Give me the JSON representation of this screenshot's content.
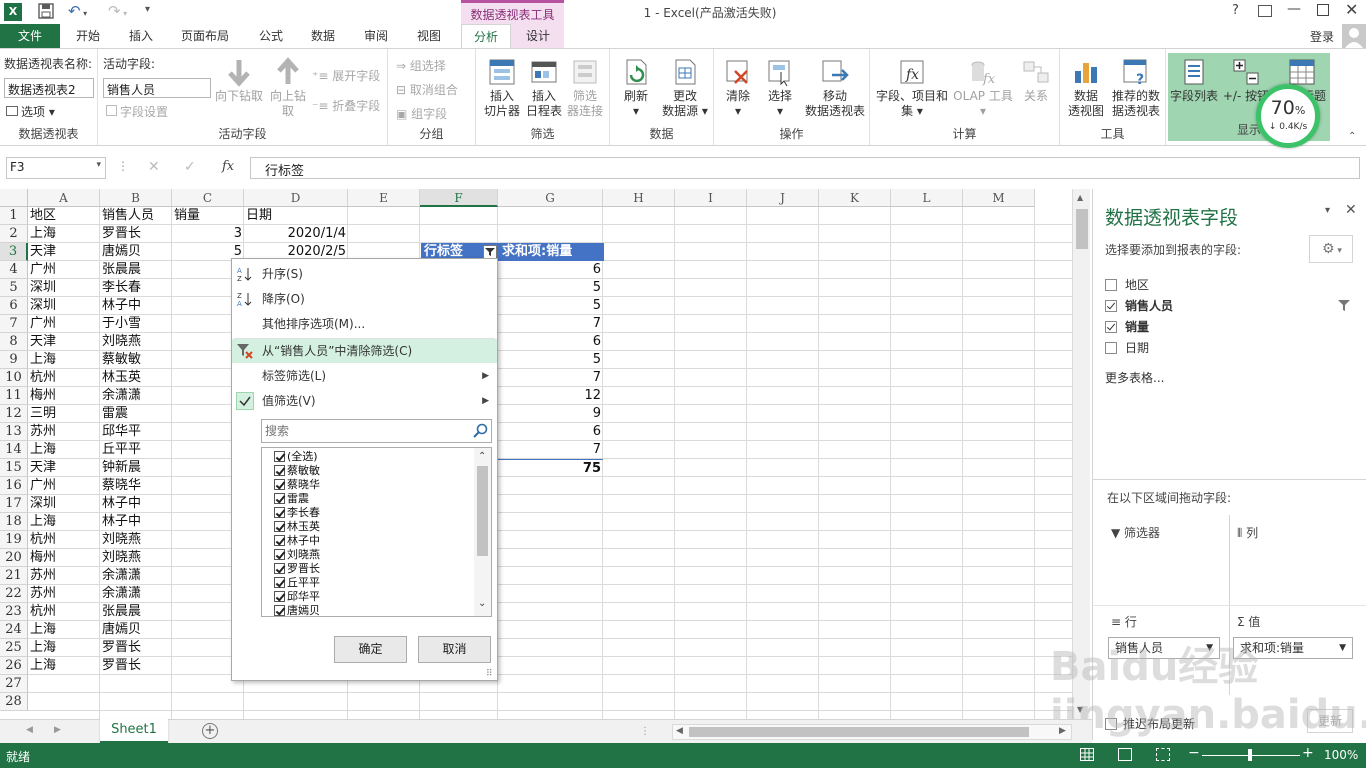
{
  "titlebar": {
    "title": "1 - Excel(产品激活失败)",
    "context_tool": "数据透视表工具",
    "help": "?",
    "login": "登录"
  },
  "tabs": [
    "文件",
    "开始",
    "插入",
    "页面布局",
    "公式",
    "数据",
    "审阅",
    "视图",
    "分析",
    "设计"
  ],
  "ribbon": {
    "pivot": {
      "name_label": "数据透视表名称:",
      "name_value": "数据透视表2",
      "options": "选项",
      "group": "数据透视表"
    },
    "active": {
      "label": "活动字段:",
      "value": "销售人员",
      "settings": "字段设置",
      "drill_down": "向下钻取",
      "drill_up": "向上钻",
      "drill_up2": "取",
      "expand": "展开字段",
      "collapse": "折叠字段",
      "group": "活动字段"
    },
    "grouping": {
      "sel": "组选择",
      "ungroup": "取消组合",
      "field": "组字段",
      "group": "分组"
    },
    "filter": {
      "slicer1": "插入",
      "slicer2": "切片器",
      "timeline1": "插入",
      "timeline2": "日程表",
      "conn1": "筛选",
      "conn2": "器连接",
      "group": "筛选"
    },
    "data": {
      "refresh": "刷新",
      "change1": "更改",
      "change2": "数据源",
      "group": "数据"
    },
    "ops": {
      "clear": "清除",
      "select": "选择",
      "move1": "移动",
      "move2": "数据透视表",
      "group": "操作"
    },
    "calc": {
      "fields1": "字段、项目和",
      "fields2": "集",
      "olap": "OLAP 工具",
      "rel": "关系",
      "group": "计算"
    },
    "tools": {
      "chart1": "数据",
      "chart2": "透视图",
      "rec1": "推荐的数",
      "rec2": "据透视表",
      "group": "工具"
    },
    "show": {
      "fieldlist": "字段列表",
      "pm": "+/- 按钮",
      "headers": "字段标题",
      "group": "显示"
    },
    "meter": {
      "percent": "70",
      "unit": "%",
      "speed": "0.4K/s"
    }
  },
  "formula": {
    "namebox": "F3",
    "fx": "fx",
    "content": "行标签"
  },
  "columns": [
    "A",
    "B",
    "C",
    "D",
    "E",
    "F",
    "G",
    "H",
    "I",
    "J",
    "K",
    "L",
    "M"
  ],
  "rows": [
    "1",
    "2",
    "3",
    "4",
    "5",
    "6",
    "7",
    "8",
    "9",
    "10",
    "11",
    "12",
    "13",
    "14",
    "15",
    "16",
    "17",
    "18",
    "19",
    "20",
    "21",
    "22",
    "23",
    "24",
    "25",
    "26",
    "27",
    "28"
  ],
  "table": {
    "headers": [
      "地区",
      "销售人员",
      "销量",
      "日期"
    ],
    "regions": [
      "上海",
      "天津",
      "广州",
      "深圳",
      "深圳",
      "广州",
      "天津",
      "上海",
      "杭州",
      "梅州",
      "三明",
      "苏州",
      "上海",
      "天津",
      "广州",
      "深圳",
      "上海",
      "杭州",
      "梅州",
      "苏州",
      "苏州",
      "杭州",
      "上海",
      "上海",
      "上海"
    ],
    "people": [
      "罗晋长",
      "唐嫣贝",
      "张晨晨",
      "李长春",
      "林子中",
      "于小雪",
      "刘晓燕",
      "蔡敏敏",
      "林玉英",
      "余潇潇",
      "雷震",
      "邱华平",
      "丘平平",
      "钟新晨",
      "蔡晓华",
      "林子中",
      "林子中",
      "刘晓燕",
      "刘晓燕",
      "余潇潇",
      "余潇潇",
      "张晨晨",
      "唐嫣贝",
      "罗晋长",
      "罗晋长"
    ],
    "c_values": [
      "3",
      "5"
    ],
    "d_values": [
      "2020/1/4",
      "2020/2/5"
    ]
  },
  "pivot": {
    "row_label": "行标签",
    "sum_label": "求和项:销量",
    "values": [
      "6",
      "5",
      "5",
      "7",
      "6",
      "5",
      "7",
      "12",
      "9",
      "6",
      "7"
    ],
    "total": "75"
  },
  "dropdown": {
    "sort_asc": "升序(S)",
    "sort_desc": "降序(O)",
    "more_sort": "其他排序选项(M)...",
    "clear_filter": "从“销售人员”中清除筛选(C)",
    "label_filter": "标签筛选(L)",
    "value_filter": "值筛选(V)",
    "search_placeholder": "搜索",
    "items": [
      "(全选)",
      "蔡敏敏",
      "蔡晓华",
      "雷震",
      "李长春",
      "林玉英",
      "林子中",
      "刘晓燕",
      "罗晋长",
      "丘平平",
      "邱华平",
      "唐嫣贝"
    ],
    "ok": "确定",
    "cancel": "取消"
  },
  "pane": {
    "title": "数据透视表字段",
    "subtitle": "选择要添加到报表的字段:",
    "fields": [
      {
        "label": "地区",
        "checked": false
      },
      {
        "label": "销售人员",
        "checked": true
      },
      {
        "label": "销量",
        "checked": true
      },
      {
        "label": "日期",
        "checked": false
      }
    ],
    "more": "更多表格...",
    "drag": "在以下区域间拖动字段:",
    "filter": "筛选器",
    "cols": "列",
    "rows": "行",
    "values": "值",
    "row_field": "销售人员",
    "value_field": "求和项:销量",
    "defer": "推迟布局更新",
    "update": "更新"
  },
  "sheet": {
    "tab": "Sheet1"
  },
  "status": {
    "ready": "就绪",
    "zoom": "100%"
  },
  "watermark": "Baidu经验 jingyan.baidu.com"
}
